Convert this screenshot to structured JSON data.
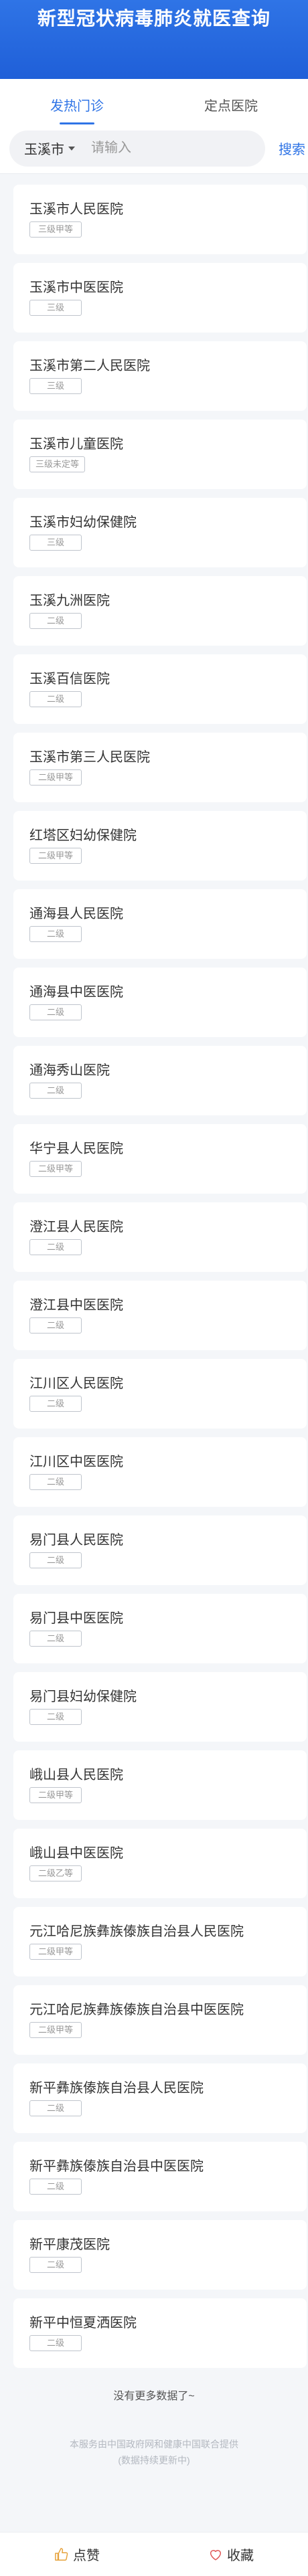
{
  "header": {
    "title": "新型冠状病毒肺炎就医查询"
  },
  "tabs": [
    {
      "label": "发热门诊",
      "active": true
    },
    {
      "label": "定点医院",
      "active": false
    }
  ],
  "search": {
    "city": "玉溪市",
    "placeholder": "请输入",
    "button": "搜索"
  },
  "hospitals": [
    {
      "name": "玉溪市人民医院",
      "level": "三级甲等"
    },
    {
      "name": "玉溪市中医医院",
      "level": "三级"
    },
    {
      "name": "玉溪市第二人民医院",
      "level": "三级"
    },
    {
      "name": "玉溪市儿童医院",
      "level": "三级未定等"
    },
    {
      "name": "玉溪市妇幼保健院",
      "level": "三级"
    },
    {
      "name": "玉溪九洲医院",
      "level": "二级"
    },
    {
      "name": "玉溪百信医院",
      "level": "二级"
    },
    {
      "name": "玉溪市第三人民医院",
      "level": "二级甲等"
    },
    {
      "name": "红塔区妇幼保健院",
      "level": "二级甲等"
    },
    {
      "name": "通海县人民医院",
      "level": "二级"
    },
    {
      "name": "通海县中医医院",
      "level": "二级"
    },
    {
      "name": "通海秀山医院",
      "level": "二级"
    },
    {
      "name": "华宁县人民医院",
      "level": "二级甲等"
    },
    {
      "name": "澄江县人民医院",
      "level": "二级"
    },
    {
      "name": "澄江县中医医院",
      "level": "二级"
    },
    {
      "name": "江川区人民医院",
      "level": "二级"
    },
    {
      "name": "江川区中医医院",
      "level": "二级"
    },
    {
      "name": "易门县人民医院",
      "level": "二级"
    },
    {
      "name": "易门县中医医院",
      "level": "二级"
    },
    {
      "name": "易门县妇幼保健院",
      "level": "二级"
    },
    {
      "name": "峨山县人民医院",
      "level": "二级甲等"
    },
    {
      "name": "峨山县中医医院",
      "level": "二级乙等"
    },
    {
      "name": "元江哈尼族彝族傣族自治县人民医院",
      "level": "二级甲等"
    },
    {
      "name": "元江哈尼族彝族傣族自治县中医医院",
      "level": "二级甲等"
    },
    {
      "name": "新平彝族傣族自治县人民医院",
      "level": "二级"
    },
    {
      "name": "新平彝族傣族自治县中医医院",
      "level": "二级"
    },
    {
      "name": "新平康茂医院",
      "level": "二级"
    },
    {
      "name": "新平中恒夏洒医院",
      "level": "二级"
    }
  ],
  "footer": {
    "no_more": "没有更多数据了~",
    "source_line1": "本服务由中国政府网和健康中国联合提供",
    "source_line2": "(数据持续更新中)"
  },
  "bottom_bar": {
    "like": "点赞",
    "favorite": "收藏"
  },
  "colors": {
    "accent": "#2f74e6",
    "header": "#1f5fd8"
  }
}
